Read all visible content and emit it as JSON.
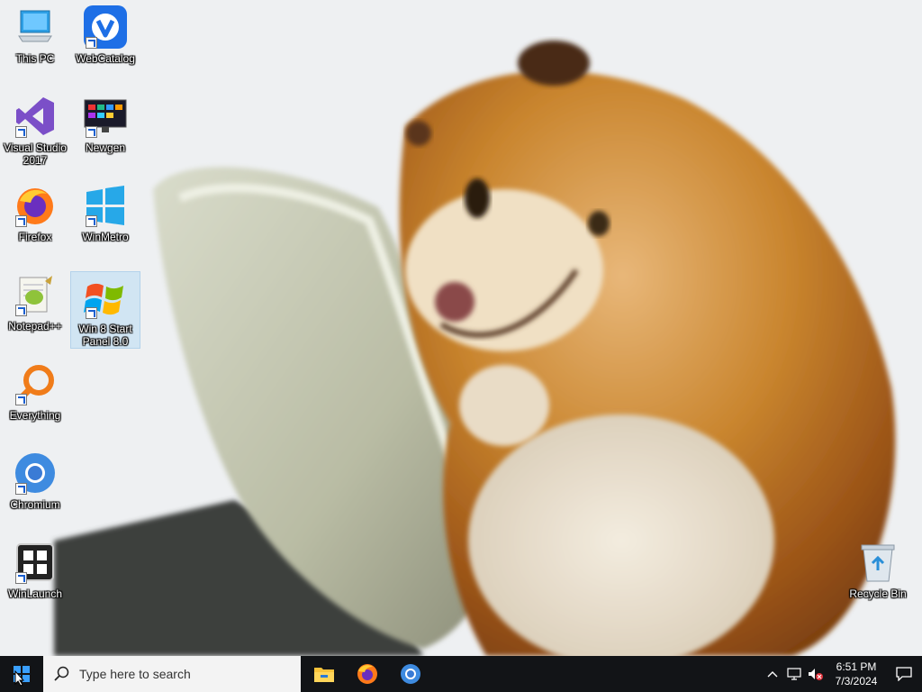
{
  "desktop": {
    "icons": [
      {
        "name": "This PC",
        "selected": false
      },
      {
        "name": "WebCatalog",
        "selected": false
      },
      {
        "name": "Visual Studio 2017",
        "selected": false
      },
      {
        "name": "Newgen",
        "selected": false
      },
      {
        "name": "Firefox",
        "selected": false
      },
      {
        "name": "WinMetro",
        "selected": false
      },
      {
        "name": "Notepad++",
        "selected": false
      },
      {
        "name": "Win 8 Start Panel 8.0",
        "selected": true
      },
      {
        "name": "Everything",
        "selected": false
      },
      {
        "name": "Chromium",
        "selected": false
      },
      {
        "name": "WinLaunch",
        "selected": false
      },
      {
        "name": "Recycle Bin",
        "selected": false
      }
    ]
  },
  "taskbar": {
    "search_placeholder": "Type here to search",
    "pinned": [
      "File Explorer",
      "Firefox",
      "Chromium"
    ],
    "clock": {
      "time": "6:51 PM",
      "date": "7/3/2024"
    }
  },
  "colors": {
    "taskbar": "#121417",
    "accent": "#1a73e8"
  }
}
